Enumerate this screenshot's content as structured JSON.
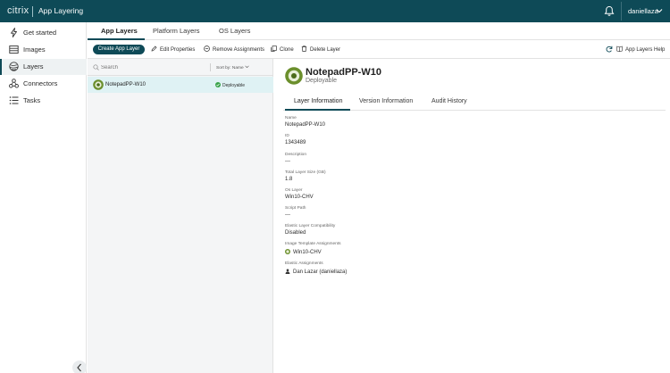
{
  "header": {
    "brand": "citrix",
    "app_title": "App Layering",
    "user": "daniellaza"
  },
  "sidebar": {
    "items": [
      {
        "label": "Get started",
        "icon": "bolt-icon"
      },
      {
        "label": "Images",
        "icon": "images-icon"
      },
      {
        "label": "Layers",
        "icon": "layers-icon",
        "active": true
      },
      {
        "label": "Connectors",
        "icon": "connectors-icon"
      },
      {
        "label": "Tasks",
        "icon": "tasks-icon"
      }
    ]
  },
  "tabs": [
    {
      "label": "App Layers",
      "active": true
    },
    {
      "label": "Platform Layers"
    },
    {
      "label": "OS Layers"
    }
  ],
  "toolbar": {
    "create_label": "Create App Layer",
    "edit_label": "Edit Properties",
    "remove_label": "Remove Assignments",
    "clone_label": "Clone",
    "delete_label": "Delete Layer",
    "help_label": "App Layers Help"
  },
  "list": {
    "search_placeholder": "Search",
    "sort_label": "Sort by: Name",
    "rows": [
      {
        "name": "NotepadPP-W10",
        "status": "Deployable"
      }
    ]
  },
  "detail": {
    "title": "NotepadPP-W10",
    "subtitle": "Deployable",
    "tabs": [
      {
        "label": "Layer Information",
        "active": true
      },
      {
        "label": "Version Information"
      },
      {
        "label": "Audit History"
      }
    ],
    "fields": {
      "name_label": "Name",
      "name_value": "NotepadPP-W10",
      "id_label": "ID",
      "id_value": "1343489",
      "description_label": "Description",
      "description_value": "---",
      "size_label": "Total Layer Size (GB)",
      "size_value": "1.8",
      "os_label": "Os Layer",
      "os_value": "Win10-CHV",
      "script_label": "Script Path",
      "script_value": "---",
      "elastic_compat_label": "Elastic Layer Compatibility",
      "elastic_compat_value": "Disabled",
      "image_assign_label": "Image Template Assignments",
      "image_assign_value": "Win10-CHV",
      "elastic_assign_label": "Elastic Assignments",
      "elastic_assign_value": "Dan Lazar (daniellaza)"
    }
  },
  "colors": {
    "brand": "#0e4a57",
    "selected_row": "#dff2f4",
    "success": "#3aa34a"
  }
}
